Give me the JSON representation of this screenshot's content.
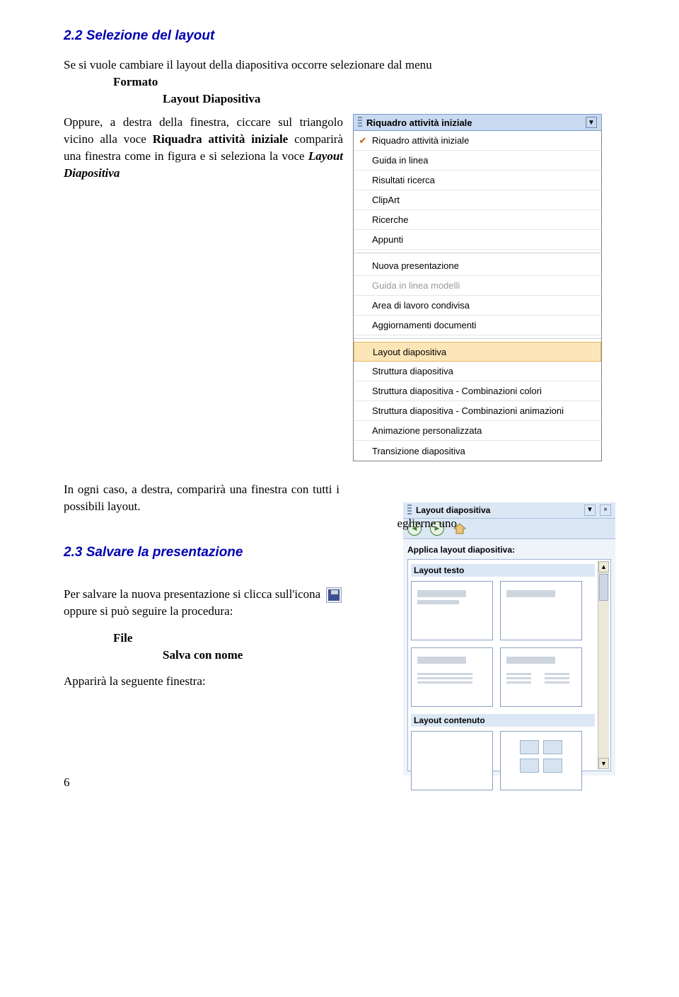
{
  "section22": {
    "heading": "2.2  Selezione del layout",
    "p1": "Se si vuole cambiare il layout della diapositiva occorre selezionare dal menu",
    "menu1": "Formato",
    "menu2": "Layout Diapositiva",
    "p2a": "Oppure, a destra della finestra, ciccare sul triangolo vicino alla voce ",
    "p2b": "Riquadra attività iniziale",
    "p2c": " comparirà una finestra come in figura e si seleziona la voce ",
    "p2d": "Layout Diapositiva"
  },
  "taskpane": {
    "title": "Riquadro attività iniziale",
    "items": [
      {
        "label": "Riquadro attività iniziale",
        "checked": true
      },
      {
        "label": "Guida in linea"
      },
      {
        "label": "Risultati ricerca"
      },
      {
        "label": "ClipArt"
      },
      {
        "label": "Ricerche"
      },
      {
        "label": "Appunti"
      },
      {
        "label": "Nuova presentazione"
      },
      {
        "label": "Guida in linea modelli",
        "dim": true
      },
      {
        "label": "Area di lavoro condivisa"
      },
      {
        "label": "Aggiornamenti documenti"
      },
      {
        "label": "Layout diapositiva",
        "selected": true
      },
      {
        "label": "Struttura diapositiva"
      },
      {
        "label": "Struttura diapositiva - Combinazioni colori"
      },
      {
        "label": "Struttura diapositiva - Combinazioni animazioni"
      },
      {
        "label": "Animazione personalizzata"
      },
      {
        "label": "Transizione diapositiva"
      }
    ]
  },
  "mid": {
    "p3": "In ogni caso, a destra, comparirà una finestra con tutti i possibili layout.",
    "p3b": "eglierne uno"
  },
  "layoutpane": {
    "title": "Layout diapositiva",
    "apply": "Applica layout diapositiva:",
    "group1": "Layout testo",
    "group2": "Layout contenuto"
  },
  "section23": {
    "heading": "2.3  Salvare la presentazione",
    "p1": "Per salvare la nuova presentazione si clicca sull'icona",
    "p2": "oppure si può seguire la procedura:",
    "menu1": "File",
    "menu2": "Salva con nome",
    "p3": "Apparirà la seguente finestra:"
  },
  "page_number": "6"
}
